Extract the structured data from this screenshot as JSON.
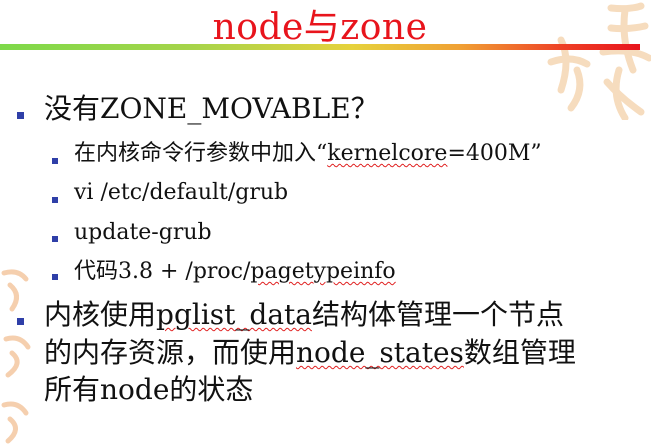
{
  "slide": {
    "title": "node与zone",
    "items": [
      {
        "level": 1,
        "text": "没有ZONE_MOVABLE？"
      },
      {
        "level": 2,
        "prefix": "在内核命令行参数中加入“",
        "term": "kernelcore",
        "suffix": "=400M”"
      },
      {
        "level": 2,
        "text": "vi /etc/default/grub"
      },
      {
        "level": 2,
        "text": "update-grub"
      },
      {
        "level": 2,
        "prefix": "代码3.8 + /proc/",
        "term": "pagetypeinfo",
        "suffix": ""
      },
      {
        "level": 1,
        "line1_prefix": "内核使用",
        "line1_term": "pglist_data",
        "line1_suffix": "结构体管理一个节点",
        "line2_prefix": "的内存资源，而使用",
        "line2_term": "node_states",
        "line2_suffix": "数组管理",
        "line3": "所有node的状态"
      }
    ]
  },
  "colors": {
    "title": "#e8141c",
    "bullet": "#2f3fa8",
    "spellcheck_underline": "#e02020"
  }
}
